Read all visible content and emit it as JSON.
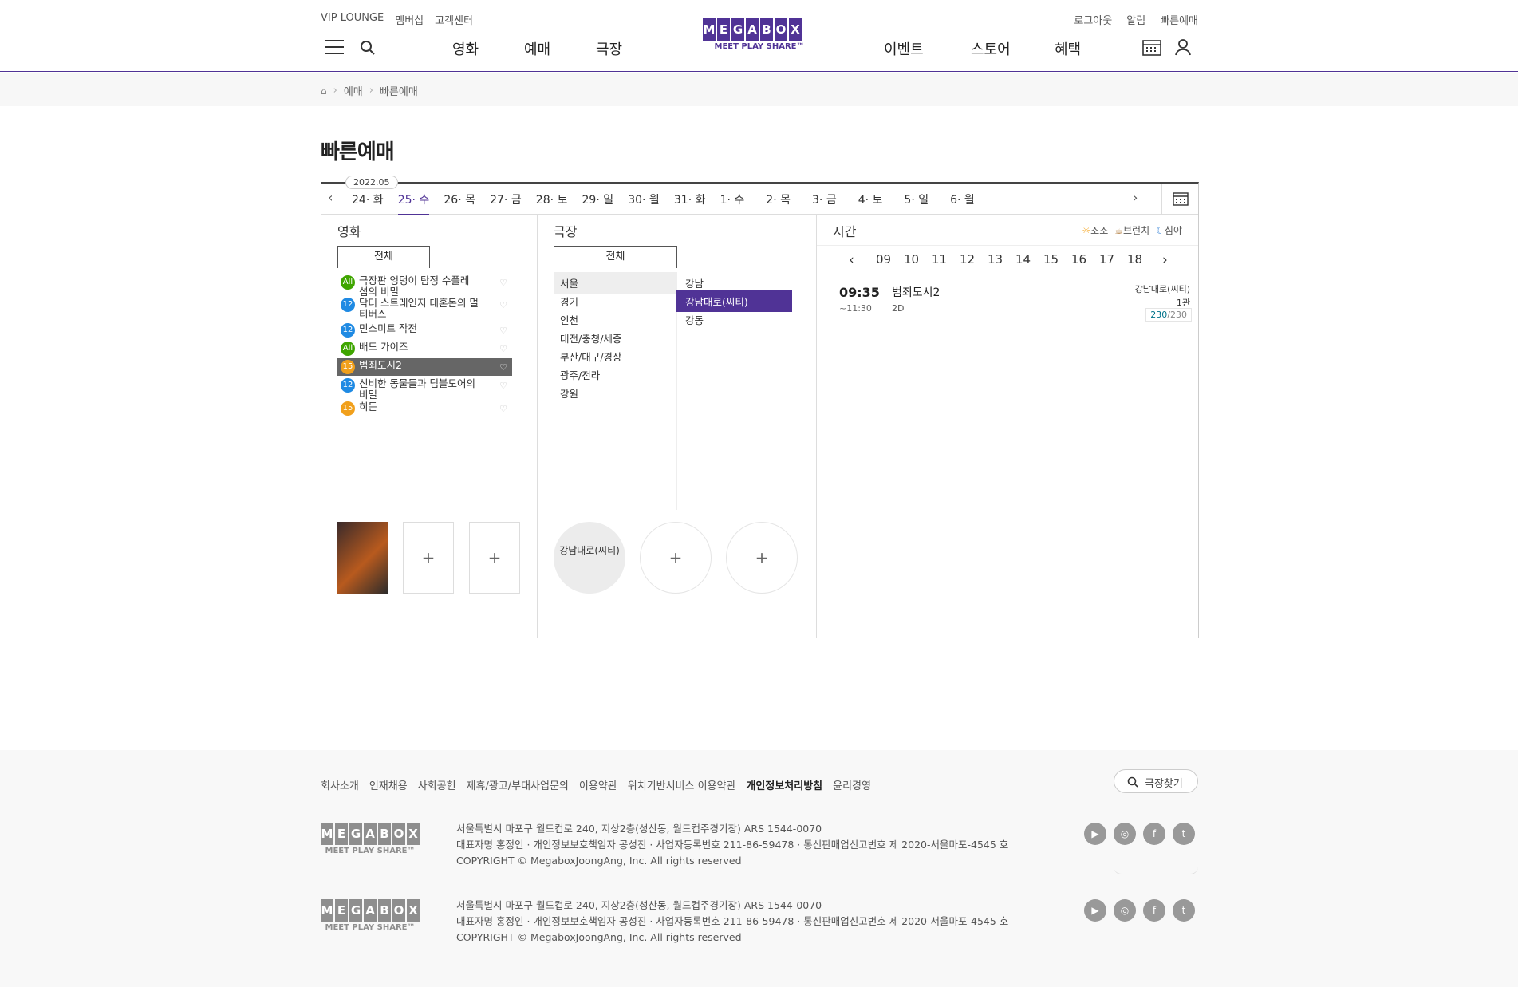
{
  "header": {
    "util_left": [
      "VIP LOUNGE",
      "멤버십",
      "고객센터"
    ],
    "util_right": [
      "로그아웃",
      "알림",
      "빠른예매"
    ],
    "nav_left": [
      "영화",
      "예매",
      "극장"
    ],
    "nav_right": [
      "이벤트",
      "스토어",
      "혜택"
    ],
    "logo": "MEGABOX",
    "logo_sub": "MEET PLAY SHARE™"
  },
  "breadcrumb": [
    "예매",
    "빠른예매"
  ],
  "page_title": "빠른예매",
  "dates": {
    "month_tag": "2022.05",
    "days": [
      {
        "d": "24",
        "w": "화"
      },
      {
        "d": "25",
        "w": "수"
      },
      {
        "d": "26",
        "w": "목"
      },
      {
        "d": "27",
        "w": "금"
      },
      {
        "d": "28",
        "w": "토"
      },
      {
        "d": "29",
        "w": "일"
      },
      {
        "d": "30",
        "w": "월"
      },
      {
        "d": "31",
        "w": "화"
      },
      {
        "d": "1",
        "w": "수"
      },
      {
        "d": "2",
        "w": "목"
      },
      {
        "d": "3",
        "w": "금"
      },
      {
        "d": "4",
        "w": "토"
      },
      {
        "d": "5",
        "w": "일"
      },
      {
        "d": "6",
        "w": "월"
      }
    ],
    "selected": 1
  },
  "movie": {
    "title": "영화",
    "tab": "전체",
    "items": [
      {
        "age": "All",
        "name": "극장판 엉덩이 탐정 수플레 섬의 비밀"
      },
      {
        "age": "12",
        "name": "닥터 스트레인지 대혼돈의 멀티버스"
      },
      {
        "age": "12",
        "name": "민스미트 작전"
      },
      {
        "age": "All",
        "name": "배드 가이즈"
      },
      {
        "age": "15",
        "name": "범죄도시2"
      },
      {
        "age": "12",
        "name": "신비한 동물들과 덤블도어의 비밀"
      },
      {
        "age": "15",
        "name": "히든"
      }
    ],
    "selected": 4
  },
  "theater": {
    "title": "극장",
    "tab": "전체",
    "regions": [
      "서울",
      "경기",
      "인천",
      "대전/충청/세종",
      "부산/대구/경상",
      "광주/전라",
      "강원"
    ],
    "theaters": [
      "강남",
      "강남대로(씨티)",
      "강동"
    ],
    "selected_theater": "강남대로(씨티)"
  },
  "time": {
    "title": "시간",
    "legend": [
      "조조",
      "브런치",
      "심야"
    ],
    "hours": [
      "09",
      "10",
      "11",
      "12",
      "13",
      "14",
      "15",
      "16",
      "17",
      "18"
    ],
    "show": {
      "start": "09:35",
      "end": "~11:30",
      "movie": "범죄도시2",
      "format": "2D",
      "theater": "강남대로(씨티)",
      "hall": "1관",
      "seats_left": "230",
      "seats_total": "/230"
    }
  },
  "footer": {
    "links": [
      "회사소개",
      "인재채용",
      "사회공헌",
      "제휴/광고/부대사업문의",
      "이용약관",
      "위치기반서비스 이용약관",
      "개인정보처리방침",
      "윤리경영"
    ],
    "find_theater": "극장찾기",
    "address": "서울특별시 마포구 월드컵로 240, 지상2층(성산동, 월드컵주경기장) ARS 1544-0070",
    "info": "대표자명 홍정인 · 개인정보보호책임자 공성진 · 사업자등록번호 211-86-59478 · 통신판매업신고번호 제 2020-서울마포-4545 호",
    "copyright": "COPYRIGHT © MegaboxJoongAng, Inc. All rights reserved"
  }
}
